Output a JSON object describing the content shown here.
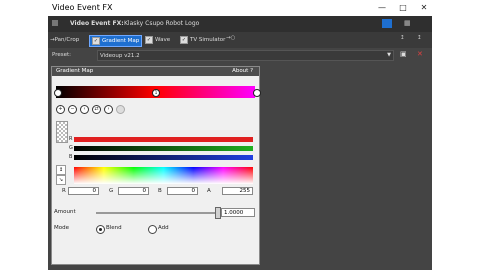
{
  "window": {
    "title": "Video Event FX",
    "min_icon": "minimize-icon",
    "max_icon": "maximize-icon",
    "close_icon": "close-icon"
  },
  "fx_header": {
    "label": "Video Event FX:",
    "event_name": "Klasky Csupo Robot Logo"
  },
  "chain": [
    {
      "label": "Pan/Crop",
      "checked": false,
      "selected": false
    },
    {
      "label": "Gradient Map",
      "checked": true,
      "selected": true
    },
    {
      "label": "Wave",
      "checked": true,
      "selected": false
    },
    {
      "label": "TV Simulator",
      "checked": true,
      "selected": false
    }
  ],
  "preset": {
    "label": "Preset:",
    "value": "Videoup v21.2"
  },
  "panel": {
    "title": "Gradient Map",
    "about": "About ?",
    "gradient": {
      "stops": [
        "#000000",
        "#ff0000",
        "#ff00ff"
      ],
      "selected_marker": "1"
    },
    "sliders": [
      {
        "label": "R",
        "color": "#e02020"
      },
      {
        "label": "G",
        "color": "#20b020"
      },
      {
        "label": "B",
        "color": "#2040e0"
      }
    ],
    "rgba": {
      "r_label": "R",
      "r": "0",
      "g_label": "G",
      "g": "0",
      "b_label": "B",
      "b": "0",
      "a_label": "A",
      "a": "255"
    },
    "amount": {
      "label": "Amount",
      "value": "1.0000",
      "level": 1.0
    },
    "mode": {
      "label": "Mode",
      "options": [
        "Blend",
        "Add"
      ],
      "selected": "Blend"
    }
  }
}
